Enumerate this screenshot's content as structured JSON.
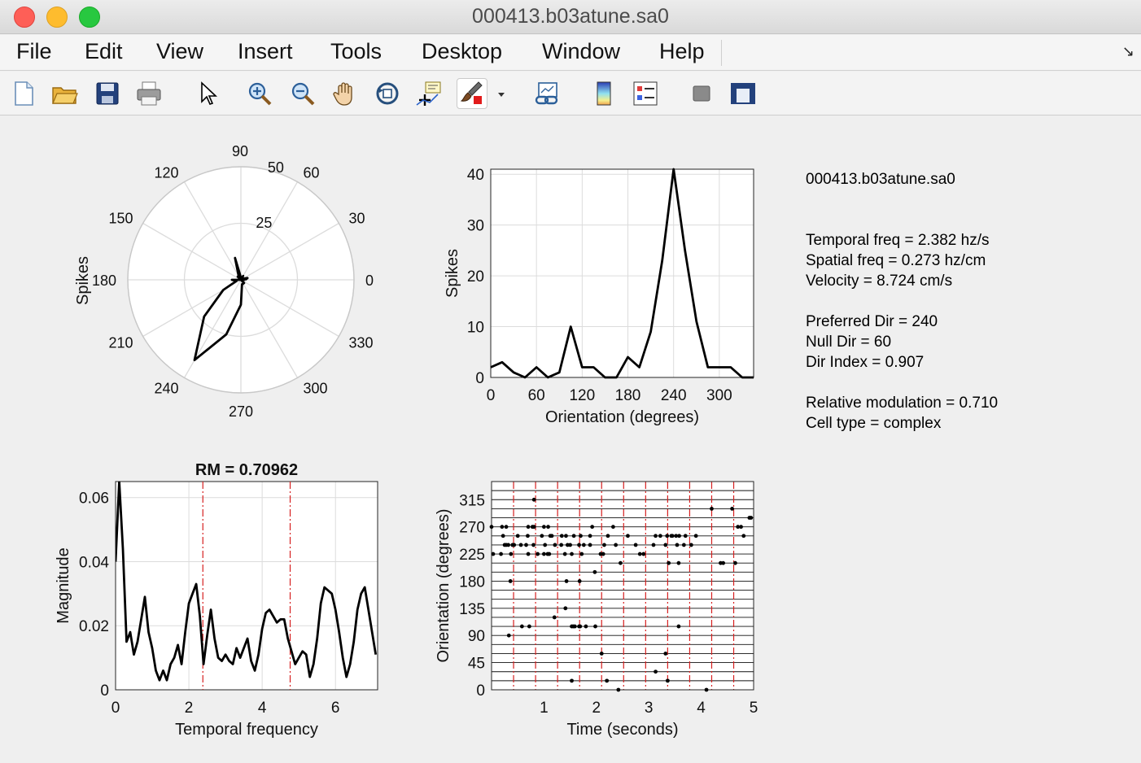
{
  "window": {
    "title": "000413.b03atune.sa0"
  },
  "menu": {
    "items": [
      "File",
      "Edit",
      "View",
      "Insert",
      "Tools",
      "Desktop",
      "Window",
      "Help"
    ]
  },
  "toolbar": {
    "icons": [
      "new-figure-icon",
      "open-file-icon",
      "save-icon",
      "print-icon",
      "pointer-icon",
      "zoom-in-icon",
      "zoom-out-icon",
      "pan-hand-icon",
      "rotate-3d-icon",
      "data-cursor-icon",
      "brush-icon",
      "brush-dropdown-icon",
      "link-plot-icon",
      "colorbar-icon",
      "legend-icon",
      "hide-plot-tools-icon",
      "show-plot-tools-icon"
    ]
  },
  "info": {
    "filename": "000413.b03atune.sa0",
    "temporal_freq": "Temporal freq = 2.382 hz/s",
    "spatial_freq": "Spatial freq = 0.273 hz/cm",
    "velocity": "Velocity = 8.724 cm/s",
    "preferred_dir": "Preferred Dir = 240",
    "null_dir": "Null Dir = 60",
    "dir_index": "Dir Index = 0.907",
    "relative_modulation": "Relative modulation = 0.710",
    "cell_type": "Cell type = complex"
  },
  "colors": {
    "line": "#000000",
    "grid": "#dcdcdc",
    "red_marker": "#d62020",
    "axes_bg": "#ffffff"
  },
  "chart_data": [
    {
      "type": "polar",
      "ylabel": "Spikes",
      "angle_ticks": [
        "0",
        "30",
        "60",
        "90",
        "120",
        "150",
        "180",
        "210",
        "240",
        "270",
        "300",
        "330"
      ],
      "radial_ticks": [
        "25",
        "50"
      ],
      "rmax": 50,
      "theta": [
        0,
        15,
        30,
        45,
        60,
        75,
        90,
        105,
        120,
        135,
        150,
        165,
        180,
        195,
        210,
        225,
        240,
        255,
        270,
        285,
        300,
        315,
        330,
        345,
        360
      ],
      "r": [
        2,
        3,
        1,
        0,
        2,
        0,
        1,
        10,
        2,
        2,
        0,
        0,
        4,
        2,
        9,
        23,
        41,
        25,
        11,
        2,
        2,
        2,
        0,
        0,
        2
      ]
    },
    {
      "type": "line",
      "xlabel": "Orientation (degrees)",
      "ylabel": "Spikes",
      "xlim": [
        0,
        345
      ],
      "ylim": [
        0,
        41
      ],
      "xticks": [
        0,
        60,
        120,
        180,
        240,
        300
      ],
      "yticks": [
        0,
        10,
        20,
        30,
        40
      ],
      "x": [
        0,
        15,
        30,
        45,
        60,
        75,
        90,
        105,
        120,
        135,
        150,
        165,
        180,
        195,
        210,
        225,
        240,
        255,
        270,
        285,
        300,
        315,
        330,
        345
      ],
      "y": [
        2,
        3,
        1,
        0,
        2,
        0,
        1,
        10,
        2,
        2,
        0,
        0,
        4,
        2,
        9,
        23,
        41,
        25,
        11,
        2,
        2,
        2,
        0,
        0
      ]
    },
    {
      "type": "line",
      "title": "RM = 0.70962",
      "xlabel": "Temporal frequency",
      "ylabel": "Magnitude",
      "xlim": [
        0,
        7.15
      ],
      "ylim": [
        0,
        0.065
      ],
      "xticks": [
        0,
        2,
        4,
        6
      ],
      "ytick_values": [
        0,
        0.02,
        0.04,
        0.06
      ],
      "ytick_labels": [
        "0",
        "0.02",
        "0.04",
        "0.06"
      ],
      "marker_lines": [
        2.382,
        4.764
      ],
      "x": [
        0,
        0.1,
        0.2,
        0.3,
        0.4,
        0.5,
        0.6,
        0.7,
        0.8,
        0.9,
        1.0,
        1.1,
        1.2,
        1.3,
        1.4,
        1.5,
        1.6,
        1.7,
        1.8,
        1.9,
        2.0,
        2.1,
        2.2,
        2.3,
        2.4,
        2.5,
        2.6,
        2.7,
        2.8,
        2.9,
        3.0,
        3.1,
        3.2,
        3.3,
        3.4,
        3.5,
        3.6,
        3.7,
        3.8,
        3.9,
        4.0,
        4.1,
        4.2,
        4.3,
        4.4,
        4.5,
        4.6,
        4.7,
        4.8,
        4.9,
        5.0,
        5.1,
        5.2,
        5.3,
        5.4,
        5.5,
        5.6,
        5.7,
        5.8,
        5.9,
        6.0,
        6.1,
        6.2,
        6.3,
        6.4,
        6.5,
        6.6,
        6.7,
        6.8,
        6.9,
        7.0,
        7.1
      ],
      "y": [
        0.04,
        0.065,
        0.044,
        0.015,
        0.018,
        0.011,
        0.015,
        0.022,
        0.029,
        0.018,
        0.013,
        0.006,
        0.003,
        0.006,
        0.003,
        0.008,
        0.01,
        0.014,
        0.008,
        0.018,
        0.027,
        0.03,
        0.033,
        0.023,
        0.008,
        0.017,
        0.025,
        0.016,
        0.01,
        0.009,
        0.011,
        0.009,
        0.008,
        0.013,
        0.01,
        0.013,
        0.016,
        0.009,
        0.006,
        0.011,
        0.019,
        0.024,
        0.025,
        0.023,
        0.021,
        0.022,
        0.022,
        0.016,
        0.012,
        0.008,
        0.01,
        0.012,
        0.011,
        0.004,
        0.008,
        0.016,
        0.027,
        0.032,
        0.031,
        0.03,
        0.025,
        0.018,
        0.01,
        0.004,
        0.008,
        0.015,
        0.025,
        0.03,
        0.032,
        0.025,
        0.018,
        0.011
      ]
    },
    {
      "type": "scatter",
      "xlabel": "Time (seconds)",
      "ylabel": "Orientation (degrees)",
      "xlim": [
        0,
        5
      ],
      "ylim": [
        0,
        345
      ],
      "xticks": [
        1,
        2,
        3,
        4,
        5
      ],
      "xtick_labels": [
        "1",
        "2",
        "3",
        "4",
        "5"
      ],
      "yticks": [
        0,
        45,
        90,
        135,
        180,
        225,
        270,
        315
      ],
      "row_step": 15,
      "red_lines": [
        0.42,
        0.84,
        1.26,
        1.68,
        2.1,
        2.52,
        2.94,
        3.36,
        3.78,
        4.2,
        4.62
      ],
      "points": [
        [
          0.81,
          315
        ],
        [
          4.2,
          300
        ],
        [
          4.59,
          300
        ],
        [
          4.92,
          285
        ],
        [
          4.95,
          285
        ],
        [
          0.0,
          270
        ],
        [
          0.2,
          270
        ],
        [
          0.28,
          270
        ],
        [
          0.7,
          270
        ],
        [
          0.78,
          270
        ],
        [
          0.81,
          270
        ],
        [
          1.0,
          270
        ],
        [
          1.08,
          270
        ],
        [
          1.92,
          270
        ],
        [
          2.32,
          270
        ],
        [
          4.7,
          270
        ],
        [
          4.76,
          270
        ],
        [
          0.22,
          255
        ],
        [
          0.5,
          255
        ],
        [
          0.69,
          255
        ],
        [
          0.96,
          255
        ],
        [
          1.12,
          255
        ],
        [
          1.15,
          255
        ],
        [
          1.34,
          255
        ],
        [
          1.42,
          255
        ],
        [
          1.57,
          255
        ],
        [
          1.7,
          255
        ],
        [
          1.88,
          255
        ],
        [
          2.22,
          255
        ],
        [
          2.6,
          255
        ],
        [
          3.13,
          255
        ],
        [
          3.22,
          255
        ],
        [
          3.35,
          255
        ],
        [
          3.43,
          255
        ],
        [
          3.45,
          255
        ],
        [
          3.52,
          255
        ],
        [
          3.58,
          255
        ],
        [
          3.7,
          255
        ],
        [
          3.9,
          255
        ],
        [
          4.81,
          255
        ],
        [
          0.25,
          240
        ],
        [
          0.28,
          240
        ],
        [
          0.32,
          240
        ],
        [
          0.4,
          240
        ],
        [
          0.43,
          240
        ],
        [
          0.56,
          240
        ],
        [
          0.66,
          240
        ],
        [
          0.8,
          240
        ],
        [
          1.02,
          240
        ],
        [
          1.21,
          240
        ],
        [
          1.33,
          240
        ],
        [
          1.45,
          240
        ],
        [
          1.5,
          240
        ],
        [
          1.67,
          240
        ],
        [
          1.76,
          240
        ],
        [
          1.88,
          240
        ],
        [
          2.15,
          240
        ],
        [
          2.37,
          240
        ],
        [
          2.75,
          240
        ],
        [
          3.09,
          240
        ],
        [
          3.32,
          240
        ],
        [
          3.54,
          240
        ],
        [
          3.67,
          240
        ],
        [
          3.81,
          240
        ],
        [
          0.03,
          225
        ],
        [
          0.18,
          225
        ],
        [
          0.37,
          225
        ],
        [
          0.7,
          225
        ],
        [
          0.88,
          225
        ],
        [
          1.0,
          225
        ],
        [
          1.07,
          225
        ],
        [
          1.1,
          225
        ],
        [
          1.4,
          225
        ],
        [
          1.53,
          225
        ],
        [
          1.72,
          225
        ],
        [
          2.08,
          225
        ],
        [
          2.13,
          225
        ],
        [
          2.83,
          225
        ],
        [
          2.9,
          225
        ],
        [
          2.46,
          210
        ],
        [
          3.38,
          210
        ],
        [
          3.57,
          210
        ],
        [
          4.37,
          210
        ],
        [
          4.42,
          210
        ],
        [
          4.65,
          210
        ],
        [
          1.97,
          195
        ],
        [
          0.36,
          180
        ],
        [
          1.43,
          180
        ],
        [
          1.68,
          180
        ],
        [
          1.41,
          135
        ],
        [
          1.2,
          120
        ],
        [
          1.53,
          105
        ],
        [
          1.56,
          105
        ],
        [
          1.59,
          105
        ],
        [
          1.67,
          105
        ],
        [
          1.69,
          105
        ],
        [
          1.8,
          105
        ],
        [
          1.98,
          105
        ],
        [
          0.58,
          105
        ],
        [
          0.72,
          105
        ],
        [
          0.33,
          90
        ],
        [
          3.57,
          105
        ],
        [
          2.1,
          60
        ],
        [
          3.32,
          60
        ],
        [
          3.13,
          30
        ],
        [
          1.53,
          15
        ],
        [
          2.2,
          15
        ],
        [
          3.36,
          15
        ],
        [
          2.42,
          0
        ],
        [
          4.1,
          0
        ]
      ]
    }
  ]
}
